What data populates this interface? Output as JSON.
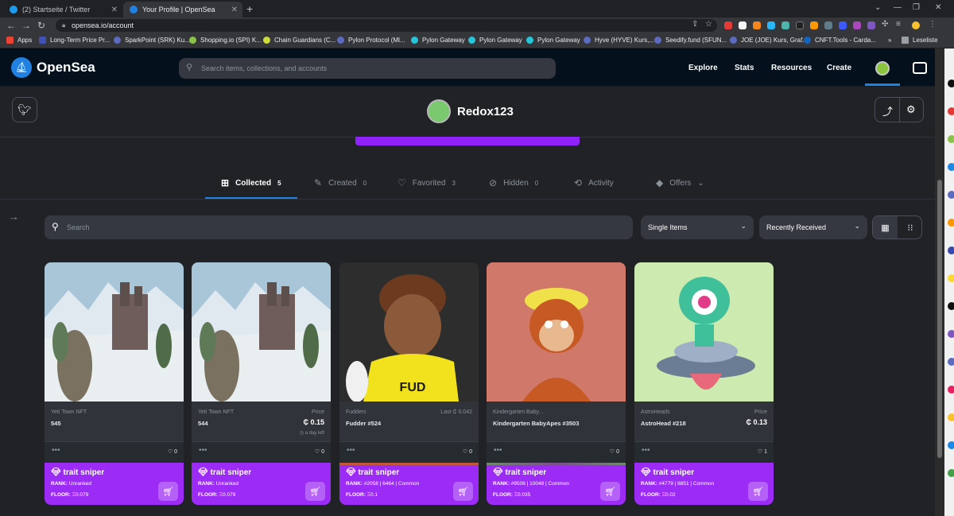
{
  "browser": {
    "tabs": [
      {
        "title": "(2) Startseite / Twitter",
        "active": false
      },
      {
        "title": "Your Profile | OpenSea",
        "active": true
      }
    ],
    "url": "opensea.io/account",
    "bookmarks": [
      "Apps",
      "Long-Term Price Pr...",
      "SparkPoint (SRK) Ku...",
      "Shopping.io (SPI) K...",
      "Chain Guardians (C...",
      "Pylon Protocol (Ml...",
      "Pylon Gateway",
      "Pylon Gateway",
      "Pylon Gateway",
      "Hyve (HYVE) Kurs,...",
      "Seedify.fund (SFUN...",
      "JOE (JOE) Kurs, Graf...",
      "CNFT.Tools - Carda..."
    ],
    "reading_list": "Leseliste"
  },
  "header": {
    "brand": "OpenSea",
    "search_placeholder": "Search items, collections, and accounts",
    "menu": [
      "Explore",
      "Stats",
      "Resources",
      "Create"
    ]
  },
  "profile": {
    "username": "Redox123"
  },
  "tabs": [
    {
      "label": "Collected",
      "count": "5",
      "icon": "collected-icon",
      "active": true
    },
    {
      "label": "Created",
      "count": "0",
      "icon": "created-icon",
      "active": false
    },
    {
      "label": "Favorited",
      "count": "3",
      "icon": "heart-icon",
      "active": false
    },
    {
      "label": "Hidden",
      "count": "0",
      "icon": "hidden-icon",
      "active": false
    },
    {
      "label": "Activity",
      "count": "",
      "icon": "activity-icon",
      "active": false
    },
    {
      "label": "Offers",
      "count": "",
      "icon": "tag-icon",
      "active": false
    }
  ],
  "filters": {
    "search_placeholder": "Search",
    "item_type": "Single Items",
    "sort": "Recently Received"
  },
  "cards": [
    {
      "collection": "Yeti Town NFT",
      "name": "545",
      "price_label": "",
      "price": "",
      "last": "",
      "time_left": "",
      "likes": "0",
      "rank": "Unranked",
      "floor": "Ξ0.079",
      "bar_color": "#9c2bf5"
    },
    {
      "collection": "Yeti Town NFT",
      "name": "544",
      "price_label": "Price",
      "price": "₵ 0.15",
      "last": "",
      "time_left": "a day left",
      "likes": "0",
      "rank": "Unranked",
      "floor": "Ξ0.079",
      "bar_color": "#9c2bf5"
    },
    {
      "collection": "Fudders",
      "name": "Fudder #524",
      "price_label": "",
      "price": "",
      "last": "Last ₵ 0.042",
      "time_left": "",
      "likes": "0",
      "rank": "#2058 | 6464 | Common",
      "floor": "Ξ0.1",
      "bar_color": "#c2573a"
    },
    {
      "collection": "Kindergarten Baby...",
      "name": "Kindergarten BabyApes #3503",
      "price_label": "",
      "price": "",
      "last": "",
      "time_left": "",
      "likes": "0",
      "rank": "#9506 | 10048 | Common",
      "floor": "Ξ0.035",
      "bar_color": "#6d8a6a"
    },
    {
      "collection": "AstroHeads",
      "name": "AstroHead #218",
      "price_label": "Price",
      "price": "₵ 0.13",
      "last": "",
      "time_left": "",
      "likes": "1",
      "rank": "#4779 | 8851 | Common",
      "floor": "Ξ0.02",
      "bar_color": "#9c2bf5"
    }
  ],
  "trait_sniper": {
    "title": "trait sniper",
    "rank_label": "RANK:",
    "floor_label": "FLOOR:"
  }
}
